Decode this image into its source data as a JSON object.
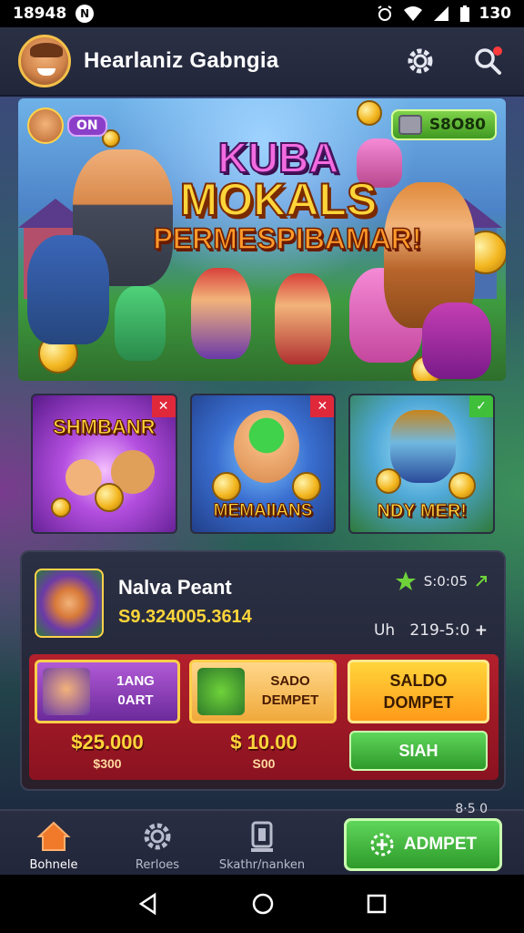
{
  "status_bar": {
    "time": "18948",
    "battery_time": "130"
  },
  "header": {
    "title": "Hearlaniz Gabngia"
  },
  "banner": {
    "line1": "KUBA",
    "line2": "MOKALS",
    "line3": "PERMESPIBAMAR!",
    "left_badge": "ON",
    "right_badge": "S8O80"
  },
  "game_cards": [
    {
      "label": "SHMBANR",
      "corner": "✕"
    },
    {
      "label": "MEMAIIANS",
      "corner": "✕"
    },
    {
      "label": "NDY MER!",
      "corner": "✓"
    }
  ],
  "wallet": {
    "name": "Nalva Peant",
    "amount": "S9.324005.3614",
    "rating": "S:0:05",
    "date_prefix": "Uh",
    "date": "219-5:0",
    "cards": [
      {
        "line1": "1ANG",
        "line2": "0ART",
        "price": "$25.000",
        "sub": "$300"
      },
      {
        "line1": "SADO",
        "line2": "DEMPET",
        "price": "$ 10.00",
        "sub": "S00"
      },
      {
        "line1": "SALDO",
        "line2": "DOMPET"
      }
    ],
    "action_label": "SIAH"
  },
  "bottom_nav": {
    "items": [
      "Bohnele",
      "Rerloes",
      "Skathr/nanken"
    ],
    "cta": "ADMPET",
    "extra": "8·5 0"
  },
  "colors": {
    "accent_gold": "#ffd53a",
    "accent_green": "#3f9a22",
    "panel_red": "#b3202c"
  }
}
